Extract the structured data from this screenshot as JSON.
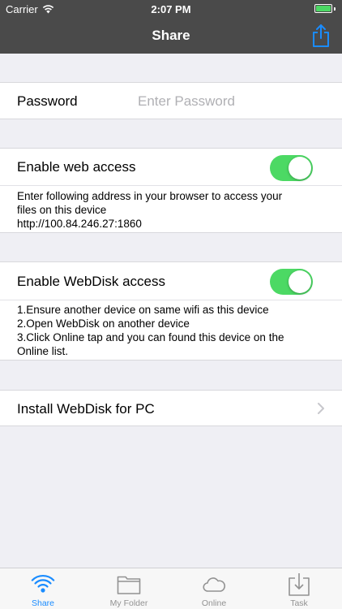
{
  "status_bar": {
    "carrier": "Carrier",
    "time": "2:07 PM"
  },
  "nav": {
    "title": "Share",
    "action_icon": "share-icon"
  },
  "password": {
    "label": "Password",
    "placeholder": "Enter Password",
    "value": ""
  },
  "web_access": {
    "label": "Enable web access",
    "enabled": true,
    "description_line1": "Enter following address in your browser to access your",
    "description_line2": "files on this device",
    "address": "http://100.84.246.27:1860"
  },
  "webdisk_access": {
    "label": "Enable WebDisk access",
    "enabled": true,
    "step1": "1.Ensure another device on same wifi as this device",
    "step2": "2.Open WebDisk on another device",
    "step3_line1": "3.Click Online tap and you can found this device on the",
    "step3_line2": "Online list."
  },
  "install": {
    "label": "Install WebDisk for PC"
  },
  "tabs": [
    {
      "label": "Share",
      "icon": "wifi-icon",
      "active": true
    },
    {
      "label": "My Folder",
      "icon": "folder-icon",
      "active": false
    },
    {
      "label": "Online",
      "icon": "cloud-icon",
      "active": false
    },
    {
      "label": "Task",
      "icon": "download-tray-icon",
      "active": false
    }
  ],
  "colors": {
    "nav_background": "#4a4a4a",
    "accent": "#1a8cff",
    "toggle_on": "#4cd964",
    "background": "#efeff4"
  }
}
